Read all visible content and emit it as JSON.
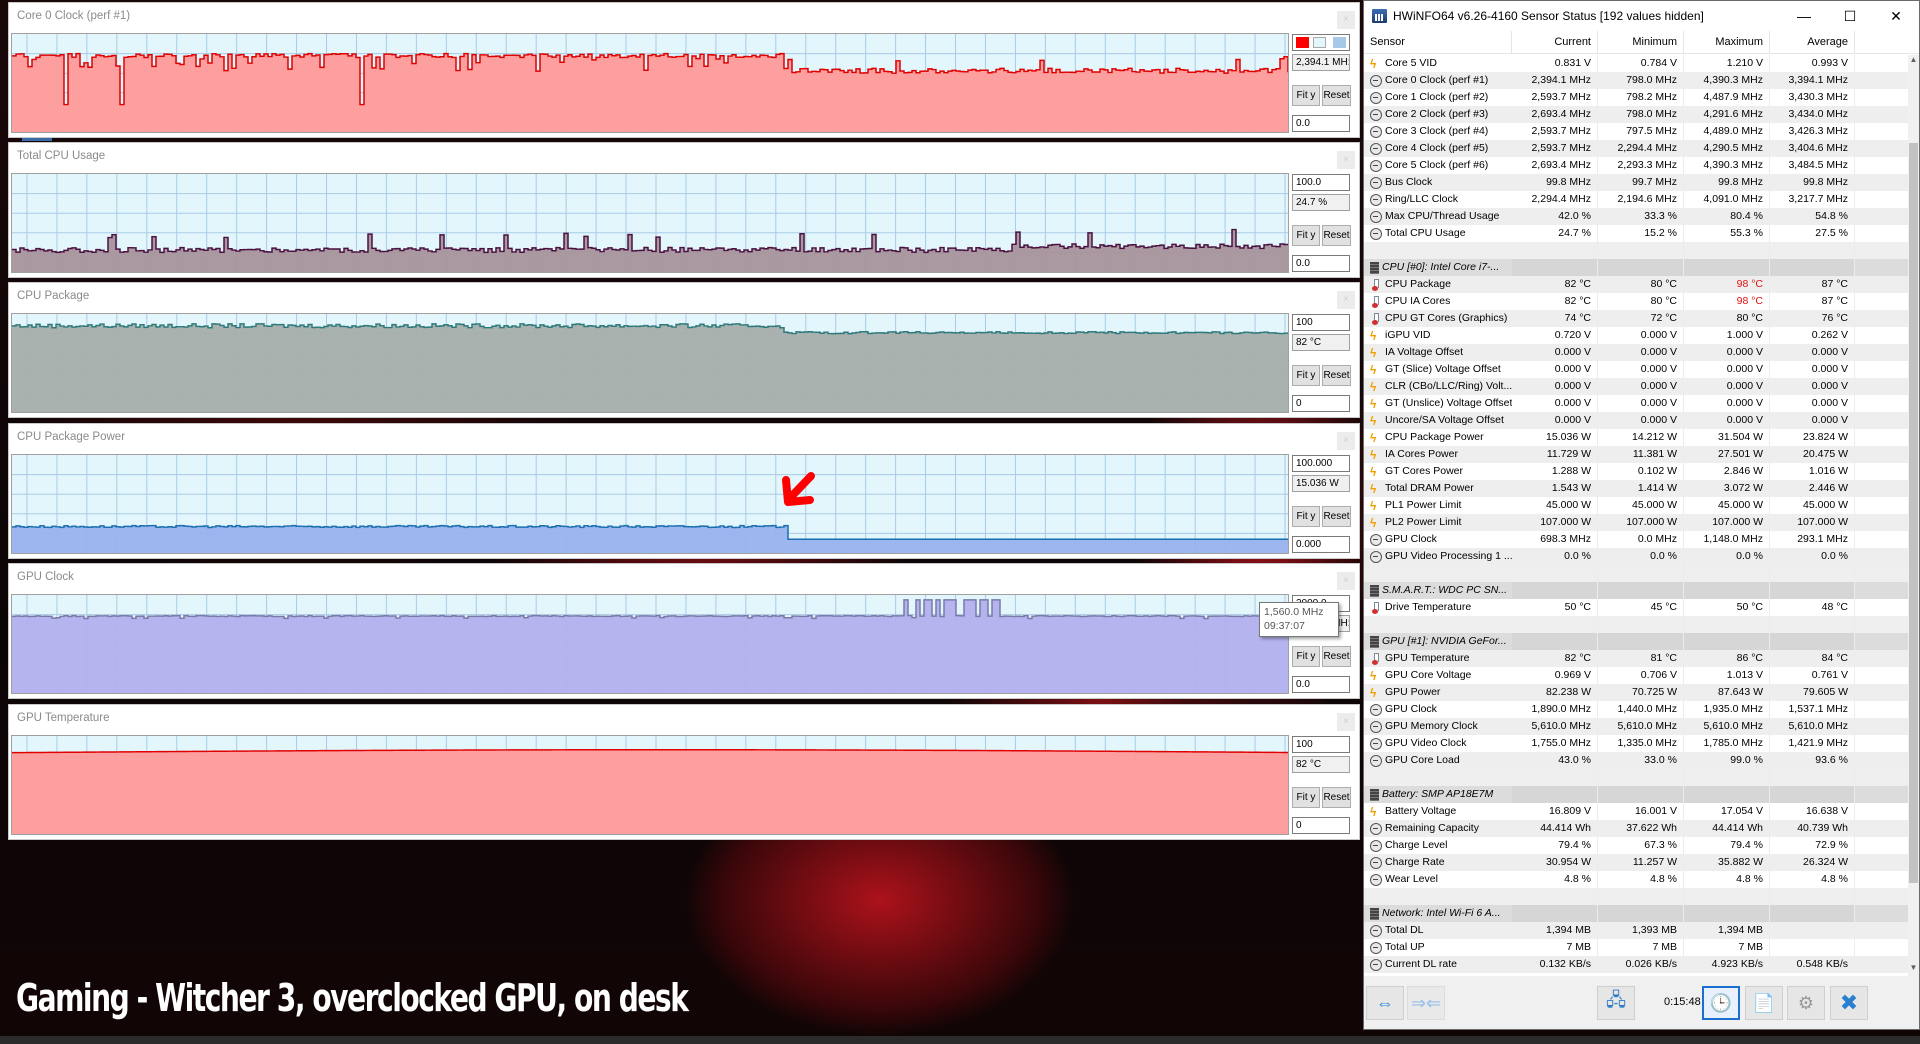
{
  "caption": "Gaming - Witcher 3, overclocked GPU, on desk",
  "annotation": {
    "type": "red-arrow",
    "points_to": "CPU Package Power drop"
  },
  "graphs": [
    {
      "title": "Core 0 Clock (perf #1)",
      "top_value": "",
      "current": "2,394.1 MH:",
      "bottom_value": "0.0",
      "fit_label": "Fit y",
      "reset_label": "Reset",
      "line_color": "#e00000",
      "fill_color": "#ff9a9a",
      "swatches": [
        "#ff0000",
        "#e2f6fc",
        "#a8c8e8"
      ]
    },
    {
      "title": "Total CPU Usage",
      "top_value": "100.0",
      "current": "24.7 %",
      "bottom_value": "0.0",
      "fit_label": "Fit y",
      "reset_label": "Reset",
      "line_color": "#4a1040",
      "fill_color": "#a8949c"
    },
    {
      "title": "CPU Package",
      "top_value": "100",
      "current": "82 °C",
      "bottom_value": "0",
      "fit_label": "Fit y",
      "reset_label": "Reset",
      "line_color": "#2e7a7a",
      "fill_color": "#a7aeac"
    },
    {
      "title": "CPU Package Power",
      "top_value": "100.000",
      "current": "15.036 W",
      "bottom_value": "0.000",
      "fit_label": "Fit y",
      "reset_label": "Reset",
      "line_color": "#1a6fb0",
      "fill_color": "#9ab2ee"
    },
    {
      "title": "GPU Clock",
      "top_value": "2000.0",
      "current": "1,560.0 MH:",
      "bottom_value": "0.0",
      "fit_label": "Fit y",
      "reset_label": "Reset",
      "line_color": "#7a7aa8",
      "fill_color": "#b2b0ee",
      "tooltip": {
        "value": "1,560.0 MHz",
        "time": "09:37:07"
      }
    },
    {
      "title": "GPU Temperature",
      "top_value": "100",
      "current": "82 °C",
      "bottom_value": "0",
      "fit_label": "Fit y",
      "reset_label": "Reset",
      "line_color": "#e00000",
      "fill_color": "#ff9a9a"
    }
  ],
  "hwinfo": {
    "title": "HWiNFO64 v6.26-4160 Sensor Status [192 values hidden]",
    "window_controls": {
      "minimize": "—",
      "maximize": "☐",
      "close": "✕"
    },
    "columns": [
      "Sensor",
      "Current",
      "Minimum",
      "Maximum",
      "Average"
    ],
    "rows": [
      {
        "type": "volt",
        "name": "Core 5 VID",
        "cur": "0.831 V",
        "min": "0.784 V",
        "max": "1.210 V",
        "avg": "0.993 V"
      },
      {
        "type": "clock",
        "name": "Core 0 Clock (perf #1)",
        "cur": "2,394.1 MHz",
        "min": "798.0 MHz",
        "max": "4,390.3 MHz",
        "avg": "3,394.1 MHz"
      },
      {
        "type": "clock",
        "name": "Core 1 Clock (perf #2)",
        "cur": "2,593.7 MHz",
        "min": "798.2 MHz",
        "max": "4,487.9 MHz",
        "avg": "3,430.3 MHz"
      },
      {
        "type": "clock",
        "name": "Core 2 Clock (perf #3)",
        "cur": "2,693.4 MHz",
        "min": "798.0 MHz",
        "max": "4,291.6 MHz",
        "avg": "3,434.0 MHz"
      },
      {
        "type": "clock",
        "name": "Core 3 Clock (perf #4)",
        "cur": "2,593.7 MHz",
        "min": "797.5 MHz",
        "max": "4,489.0 MHz",
        "avg": "3,426.3 MHz"
      },
      {
        "type": "clock",
        "name": "Core 4 Clock (perf #5)",
        "cur": "2,593.7 MHz",
        "min": "2,294.4 MHz",
        "max": "4,290.5 MHz",
        "avg": "3,404.6 MHz"
      },
      {
        "type": "clock",
        "name": "Core 5 Clock (perf #6)",
        "cur": "2,693.4 MHz",
        "min": "2,293.3 MHz",
        "max": "4,390.3 MHz",
        "avg": "3,484.5 MHz"
      },
      {
        "type": "clock",
        "name": "Bus Clock",
        "cur": "99.8 MHz",
        "min": "99.7 MHz",
        "max": "99.8 MHz",
        "avg": "99.8 MHz"
      },
      {
        "type": "clock",
        "name": "Ring/LLC Clock",
        "cur": "2,294.4 MHz",
        "min": "2,194.6 MHz",
        "max": "4,091.0 MHz",
        "avg": "3,217.7 MHz"
      },
      {
        "type": "clock",
        "name": "Max CPU/Thread Usage",
        "cur": "42.0 %",
        "min": "33.3 %",
        "max": "80.4 %",
        "avg": "54.8 %"
      },
      {
        "type": "clock",
        "name": "Total CPU Usage",
        "cur": "24.7 %",
        "min": "15.2 %",
        "max": "55.3 %",
        "avg": "27.5 %"
      },
      {
        "type": "blank",
        "name": "",
        "cur": "",
        "min": "",
        "max": "",
        "avg": ""
      },
      {
        "type": "group",
        "name": "CPU [#0]: Intel Core i7-...",
        "cur": "",
        "min": "",
        "max": "",
        "avg": ""
      },
      {
        "type": "temp",
        "name": "CPU Package",
        "cur": "82 °C",
        "min": "80 °C",
        "max": "98 °C",
        "avg": "87 °C",
        "max_alert": true
      },
      {
        "type": "temp",
        "name": "CPU IA Cores",
        "cur": "82 °C",
        "min": "80 °C",
        "max": "98 °C",
        "avg": "87 °C",
        "max_alert": true
      },
      {
        "type": "temp",
        "name": "CPU GT Cores (Graphics)",
        "cur": "74 °C",
        "min": "72 °C",
        "max": "80 °C",
        "avg": "76 °C"
      },
      {
        "type": "volt",
        "name": "iGPU VID",
        "cur": "0.720 V",
        "min": "0.000 V",
        "max": "1.000 V",
        "avg": "0.262 V"
      },
      {
        "type": "volt",
        "name": "IA Voltage Offset",
        "cur": "0.000 V",
        "min": "0.000 V",
        "max": "0.000 V",
        "avg": "0.000 V"
      },
      {
        "type": "volt",
        "name": "GT (Slice) Voltage Offset",
        "cur": "0.000 V",
        "min": "0.000 V",
        "max": "0.000 V",
        "avg": "0.000 V"
      },
      {
        "type": "volt",
        "name": "CLR (CBo/LLC/Ring) Volt...",
        "cur": "0.000 V",
        "min": "0.000 V",
        "max": "0.000 V",
        "avg": "0.000 V"
      },
      {
        "type": "volt",
        "name": "GT (Unslice) Voltage Offset",
        "cur": "0.000 V",
        "min": "0.000 V",
        "max": "0.000 V",
        "avg": "0.000 V"
      },
      {
        "type": "volt",
        "name": "Uncore/SA Voltage Offset",
        "cur": "0.000 V",
        "min": "0.000 V",
        "max": "0.000 V",
        "avg": "0.000 V"
      },
      {
        "type": "volt",
        "name": "CPU Package Power",
        "cur": "15.036 W",
        "min": "14.212 W",
        "max": "31.504 W",
        "avg": "23.824 W"
      },
      {
        "type": "volt",
        "name": "IA Cores Power",
        "cur": "11.729 W",
        "min": "11.381 W",
        "max": "27.501 W",
        "avg": "20.475 W"
      },
      {
        "type": "volt",
        "name": "GT Cores Power",
        "cur": "1.288 W",
        "min": "0.102 W",
        "max": "2.846 W",
        "avg": "1.016 W"
      },
      {
        "type": "volt",
        "name": "Total DRAM Power",
        "cur": "1.543 W",
        "min": "1.414 W",
        "max": "3.072 W",
        "avg": "2.446 W"
      },
      {
        "type": "volt",
        "name": "PL1 Power Limit",
        "cur": "45.000 W",
        "min": "45.000 W",
        "max": "45.000 W",
        "avg": "45.000 W"
      },
      {
        "type": "volt",
        "name": "PL2 Power Limit",
        "cur": "107.000 W",
        "min": "107.000 W",
        "max": "107.000 W",
        "avg": "107.000 W"
      },
      {
        "type": "clock",
        "name": "GPU Clock",
        "cur": "698.3 MHz",
        "min": "0.0 MHz",
        "max": "1,148.0 MHz",
        "avg": "293.1 MHz"
      },
      {
        "type": "clock",
        "name": "GPU Video Processing 1 ...",
        "cur": "0.0 %",
        "min": "0.0 %",
        "max": "0.0 %",
        "avg": "0.0 %"
      },
      {
        "type": "blank",
        "name": "",
        "cur": "",
        "min": "",
        "max": "",
        "avg": ""
      },
      {
        "type": "group",
        "name": "S.M.A.R.T.: WDC PC SN...",
        "cur": "",
        "min": "",
        "max": "",
        "avg": ""
      },
      {
        "type": "temp",
        "name": "Drive Temperature",
        "cur": "50 °C",
        "min": "45 °C",
        "max": "50 °C",
        "avg": "48 °C"
      },
      {
        "type": "blank",
        "name": "",
        "cur": "",
        "min": "",
        "max": "",
        "avg": ""
      },
      {
        "type": "group",
        "name": "GPU [#1]: NVIDIA GeFor...",
        "cur": "",
        "min": "",
        "max": "",
        "avg": ""
      },
      {
        "type": "temp",
        "name": "GPU Temperature",
        "cur": "82 °C",
        "min": "81 °C",
        "max": "86 °C",
        "avg": "84 °C"
      },
      {
        "type": "volt",
        "name": "GPU Core Voltage",
        "cur": "0.969 V",
        "min": "0.706 V",
        "max": "1.013 V",
        "avg": "0.761 V"
      },
      {
        "type": "volt",
        "name": "GPU Power",
        "cur": "82.238 W",
        "min": "70.725 W",
        "max": "87.643 W",
        "avg": "79.605 W"
      },
      {
        "type": "clock",
        "name": "GPU Clock",
        "cur": "1,890.0 MHz",
        "min": "1,440.0 MHz",
        "max": "1,935.0 MHz",
        "avg": "1,537.1 MHz"
      },
      {
        "type": "clock",
        "name": "GPU Memory Clock",
        "cur": "5,610.0 MHz",
        "min": "5,610.0 MHz",
        "max": "5,610.0 MHz",
        "avg": "5,610.0 MHz"
      },
      {
        "type": "clock",
        "name": "GPU Video Clock",
        "cur": "1,755.0 MHz",
        "min": "1,335.0 MHz",
        "max": "1,785.0 MHz",
        "avg": "1,421.9 MHz"
      },
      {
        "type": "clock",
        "name": "GPU Core Load",
        "cur": "43.0 %",
        "min": "33.0 %",
        "max": "99.0 %",
        "avg": "93.6 %"
      },
      {
        "type": "blank",
        "name": "",
        "cur": "",
        "min": "",
        "max": "",
        "avg": ""
      },
      {
        "type": "group",
        "name": "Battery: SMP  AP18E7M",
        "cur": "",
        "min": "",
        "max": "",
        "avg": ""
      },
      {
        "type": "volt",
        "name": "Battery Voltage",
        "cur": "16.809 V",
        "min": "16.001 V",
        "max": "17.054 V",
        "avg": "16.638 V"
      },
      {
        "type": "clock",
        "name": "Remaining Capacity",
        "cur": "44.414 Wh",
        "min": "37.622 Wh",
        "max": "44.414 Wh",
        "avg": "40.739 Wh"
      },
      {
        "type": "clock",
        "name": "Charge Level",
        "cur": "79.4 %",
        "min": "67.3 %",
        "max": "79.4 %",
        "avg": "72.9 %"
      },
      {
        "type": "clock",
        "name": "Charge Rate",
        "cur": "30.954 W",
        "min": "11.257 W",
        "max": "35.882 W",
        "avg": "26.324 W"
      },
      {
        "type": "clock",
        "name": "Wear Level",
        "cur": "4.8 %",
        "min": "4.8 %",
        "max": "4.8 %",
        "avg": "4.8 %"
      },
      {
        "type": "blank",
        "name": "",
        "cur": "",
        "min": "",
        "max": "",
        "avg": ""
      },
      {
        "type": "group",
        "name": "Network: Intel Wi-Fi 6 A...",
        "cur": "",
        "min": "",
        "max": "",
        "avg": ""
      },
      {
        "type": "clock",
        "name": "Total DL",
        "cur": "1,394 MB",
        "min": "1,393 MB",
        "max": "1,394 MB",
        "avg": ""
      },
      {
        "type": "clock",
        "name": "Total UP",
        "cur": "7 MB",
        "min": "7 MB",
        "max": "7 MB",
        "avg": ""
      },
      {
        "type": "clock",
        "name": "Current DL rate",
        "cur": "0.132 KB/s",
        "min": "0.026 KB/s",
        "max": "4.923 KB/s",
        "avg": "0.548 KB/s"
      }
    ],
    "toolbar": {
      "expand_icon": "expand-arrows-icon",
      "collapse_icon": "collapse-arrows-icon",
      "network_icon": "network-computers-icon",
      "elapsed": "0:15:48",
      "clock_icon": "clock-icon",
      "log_icon": "add-log-icon",
      "settings_icon": "gear-icon",
      "close_icon": "close-x-icon"
    }
  }
}
